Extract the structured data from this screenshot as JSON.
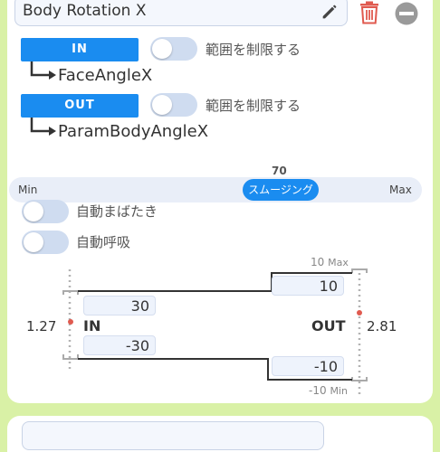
{
  "name_field": {
    "value": "Body Rotation X"
  },
  "input": {
    "button_label": "IN",
    "limit_label": "範囲を制限する",
    "parameter": "FaceAngleX"
  },
  "output": {
    "button_label": "OUT",
    "limit_label": "範囲を制限する",
    "parameter": "ParamBodyAngleX"
  },
  "smoothing": {
    "label": "スムージング",
    "value": "70",
    "min_label": "Min",
    "max_label": "Max"
  },
  "auto_blink": {
    "label": "自動まばたき"
  },
  "auto_breath": {
    "label": "自動呼吸"
  },
  "range": {
    "in_label": "IN",
    "out_label": "OUT",
    "in_value": "1.27",
    "out_value": "2.81",
    "in_max": "30",
    "in_min": "-30",
    "out_max": "10",
    "out_min": "-10",
    "out_max_caption": "10",
    "out_min_caption": "-10",
    "max_word": "Max",
    "min_word": "Min"
  },
  "colors": {
    "accent": "#1a8cf0",
    "background": "#d9f1a6",
    "trash": "#e05a4f",
    "marker": "#e05a4f"
  }
}
